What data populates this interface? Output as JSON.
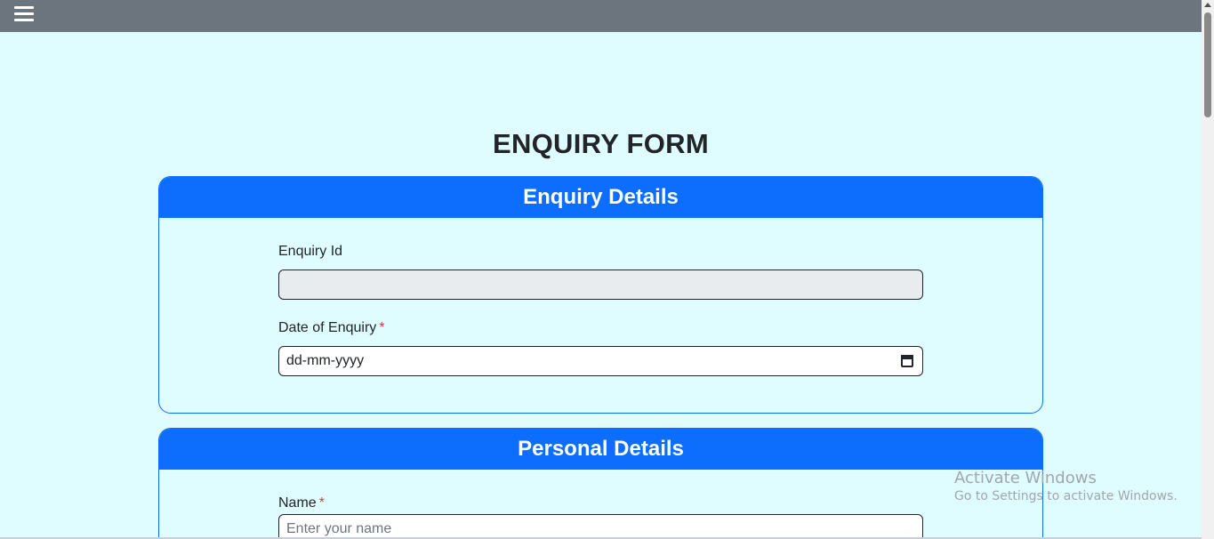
{
  "page": {
    "title": "ENQUIRY FORM"
  },
  "sections": {
    "enquiry": {
      "header": "Enquiry Details",
      "enquiry_id_label": "Enquiry Id",
      "enquiry_id_value": "",
      "date_label": "Date of Enquiry",
      "date_required": "*",
      "date_placeholder": "dd-mm-yyyy"
    },
    "personal": {
      "header": "Personal Details",
      "name_label": "Name",
      "name_required": "*",
      "name_placeholder": "Enter your name"
    }
  },
  "watermark": {
    "title": "Activate Windows",
    "subtitle": "Go to Settings to activate Windows."
  },
  "colors": {
    "page_background": "#dffdfe",
    "topbar": "#6c757d",
    "primary": "#0d6efd",
    "required": "#dc3545"
  },
  "icons": {
    "menu": "hamburger-menu-icon",
    "date": "calendar-icon"
  }
}
